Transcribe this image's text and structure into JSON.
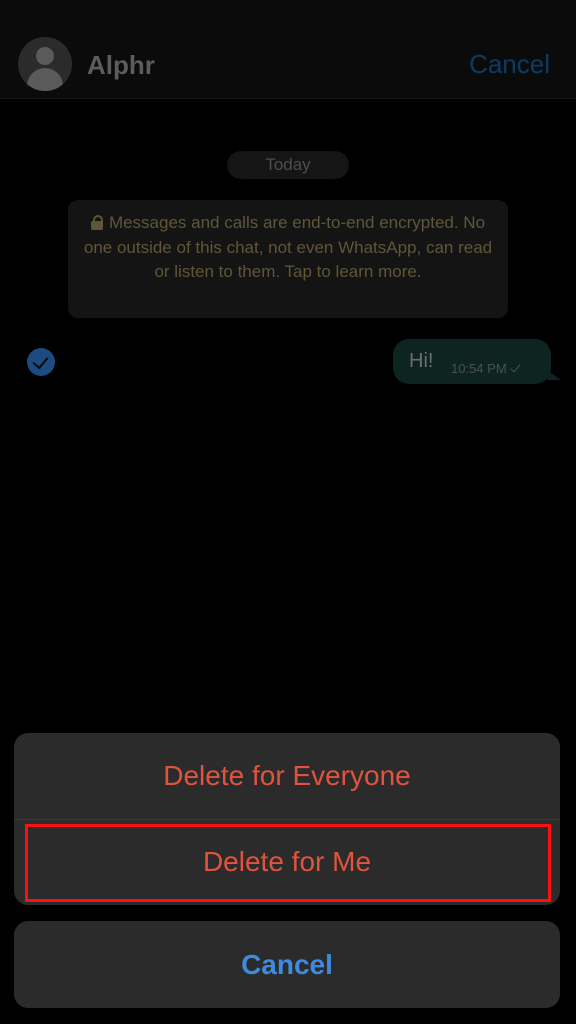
{
  "header": {
    "contact_name": "Alphr",
    "cancel_label": "Cancel"
  },
  "chat": {
    "date_label": "Today",
    "encryption_notice": "Messages and calls are end-to-end encrypted. No one outside of this chat, not even WhatsApp, can read or listen to them. Tap to learn more.",
    "messages": [
      {
        "text": "Hi!",
        "time": "10:54 PM",
        "selected": true
      }
    ]
  },
  "action_sheet": {
    "delete_everyone_label": "Delete for Everyone",
    "delete_me_label": "Delete for Me",
    "cancel_label": "Cancel"
  },
  "colors": {
    "destructive": "#e0533f",
    "cancel_blue": "#3d8be0",
    "highlight": "#ff1010",
    "sheet_bg": "#2b2b2c"
  }
}
